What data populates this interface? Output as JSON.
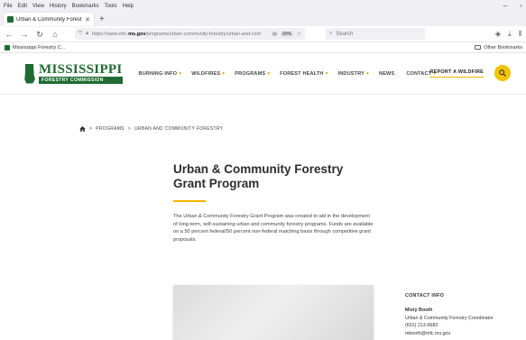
{
  "browser": {
    "menu": [
      "File",
      "Edit",
      "View",
      "History",
      "Bookmarks",
      "Tools",
      "Help"
    ],
    "window_controls": {
      "minimize": "–",
      "restore": "▫"
    },
    "tab": {
      "title": "Urban & Community Forestry G",
      "close": "✕"
    },
    "new_tab": "+",
    "url": {
      "prefix": "https://www.mfc.",
      "domain": "ms.gov",
      "rest": "/programs/urban-community-forestry/urban-and-com"
    },
    "zoom": "90%",
    "search_placeholder": "Search",
    "bookmark": "Mississippi Forestry C...",
    "other_bookmarks": "Other Bookmarks"
  },
  "site": {
    "logo": {
      "name": "MISSISSIPPI",
      "sub": "FORESTRY COMMISSION"
    },
    "nav": [
      {
        "label": "BURNING INFO",
        "caret": "▾"
      },
      {
        "label": "WILDFIRES",
        "caret": "▾"
      },
      {
        "label": "PROGRAMS",
        "caret": "▾"
      },
      {
        "label": "FOREST HEALTH",
        "caret": "▾"
      },
      {
        "label": "INDUSTRY",
        "caret": "▾"
      },
      {
        "label": "NEWS",
        "caret": ""
      },
      {
        "label": "CONTACT",
        "caret": "▾"
      }
    ],
    "report_link": "REPORT A WILDFIRE"
  },
  "colors": {
    "brand_green": "#1f6b32",
    "accent_gold": "#f5c300"
  },
  "page": {
    "breadcrumb": {
      "sep": ">",
      "items": [
        "PROGRAMS",
        "URBAN AND COMMUNITY FORESTRY"
      ]
    },
    "title": "Urban & Community Forestry Grant Program",
    "intro": "The Urban & Community Forestry Grant Program was created to aid in the development of long-term, self-sustaining urban and community forestry programs. Funds are available on a 50 percent federal/50 percent non-federal matching basis through competitive grant proposals.",
    "contact": {
      "heading": "CONTACT INFO",
      "name": "Misty Booth",
      "role": "Urban & Community Forestry Coordinator",
      "phone": "(601) 213-6683",
      "email": "mbooth@mfc.ms.gov"
    }
  }
}
